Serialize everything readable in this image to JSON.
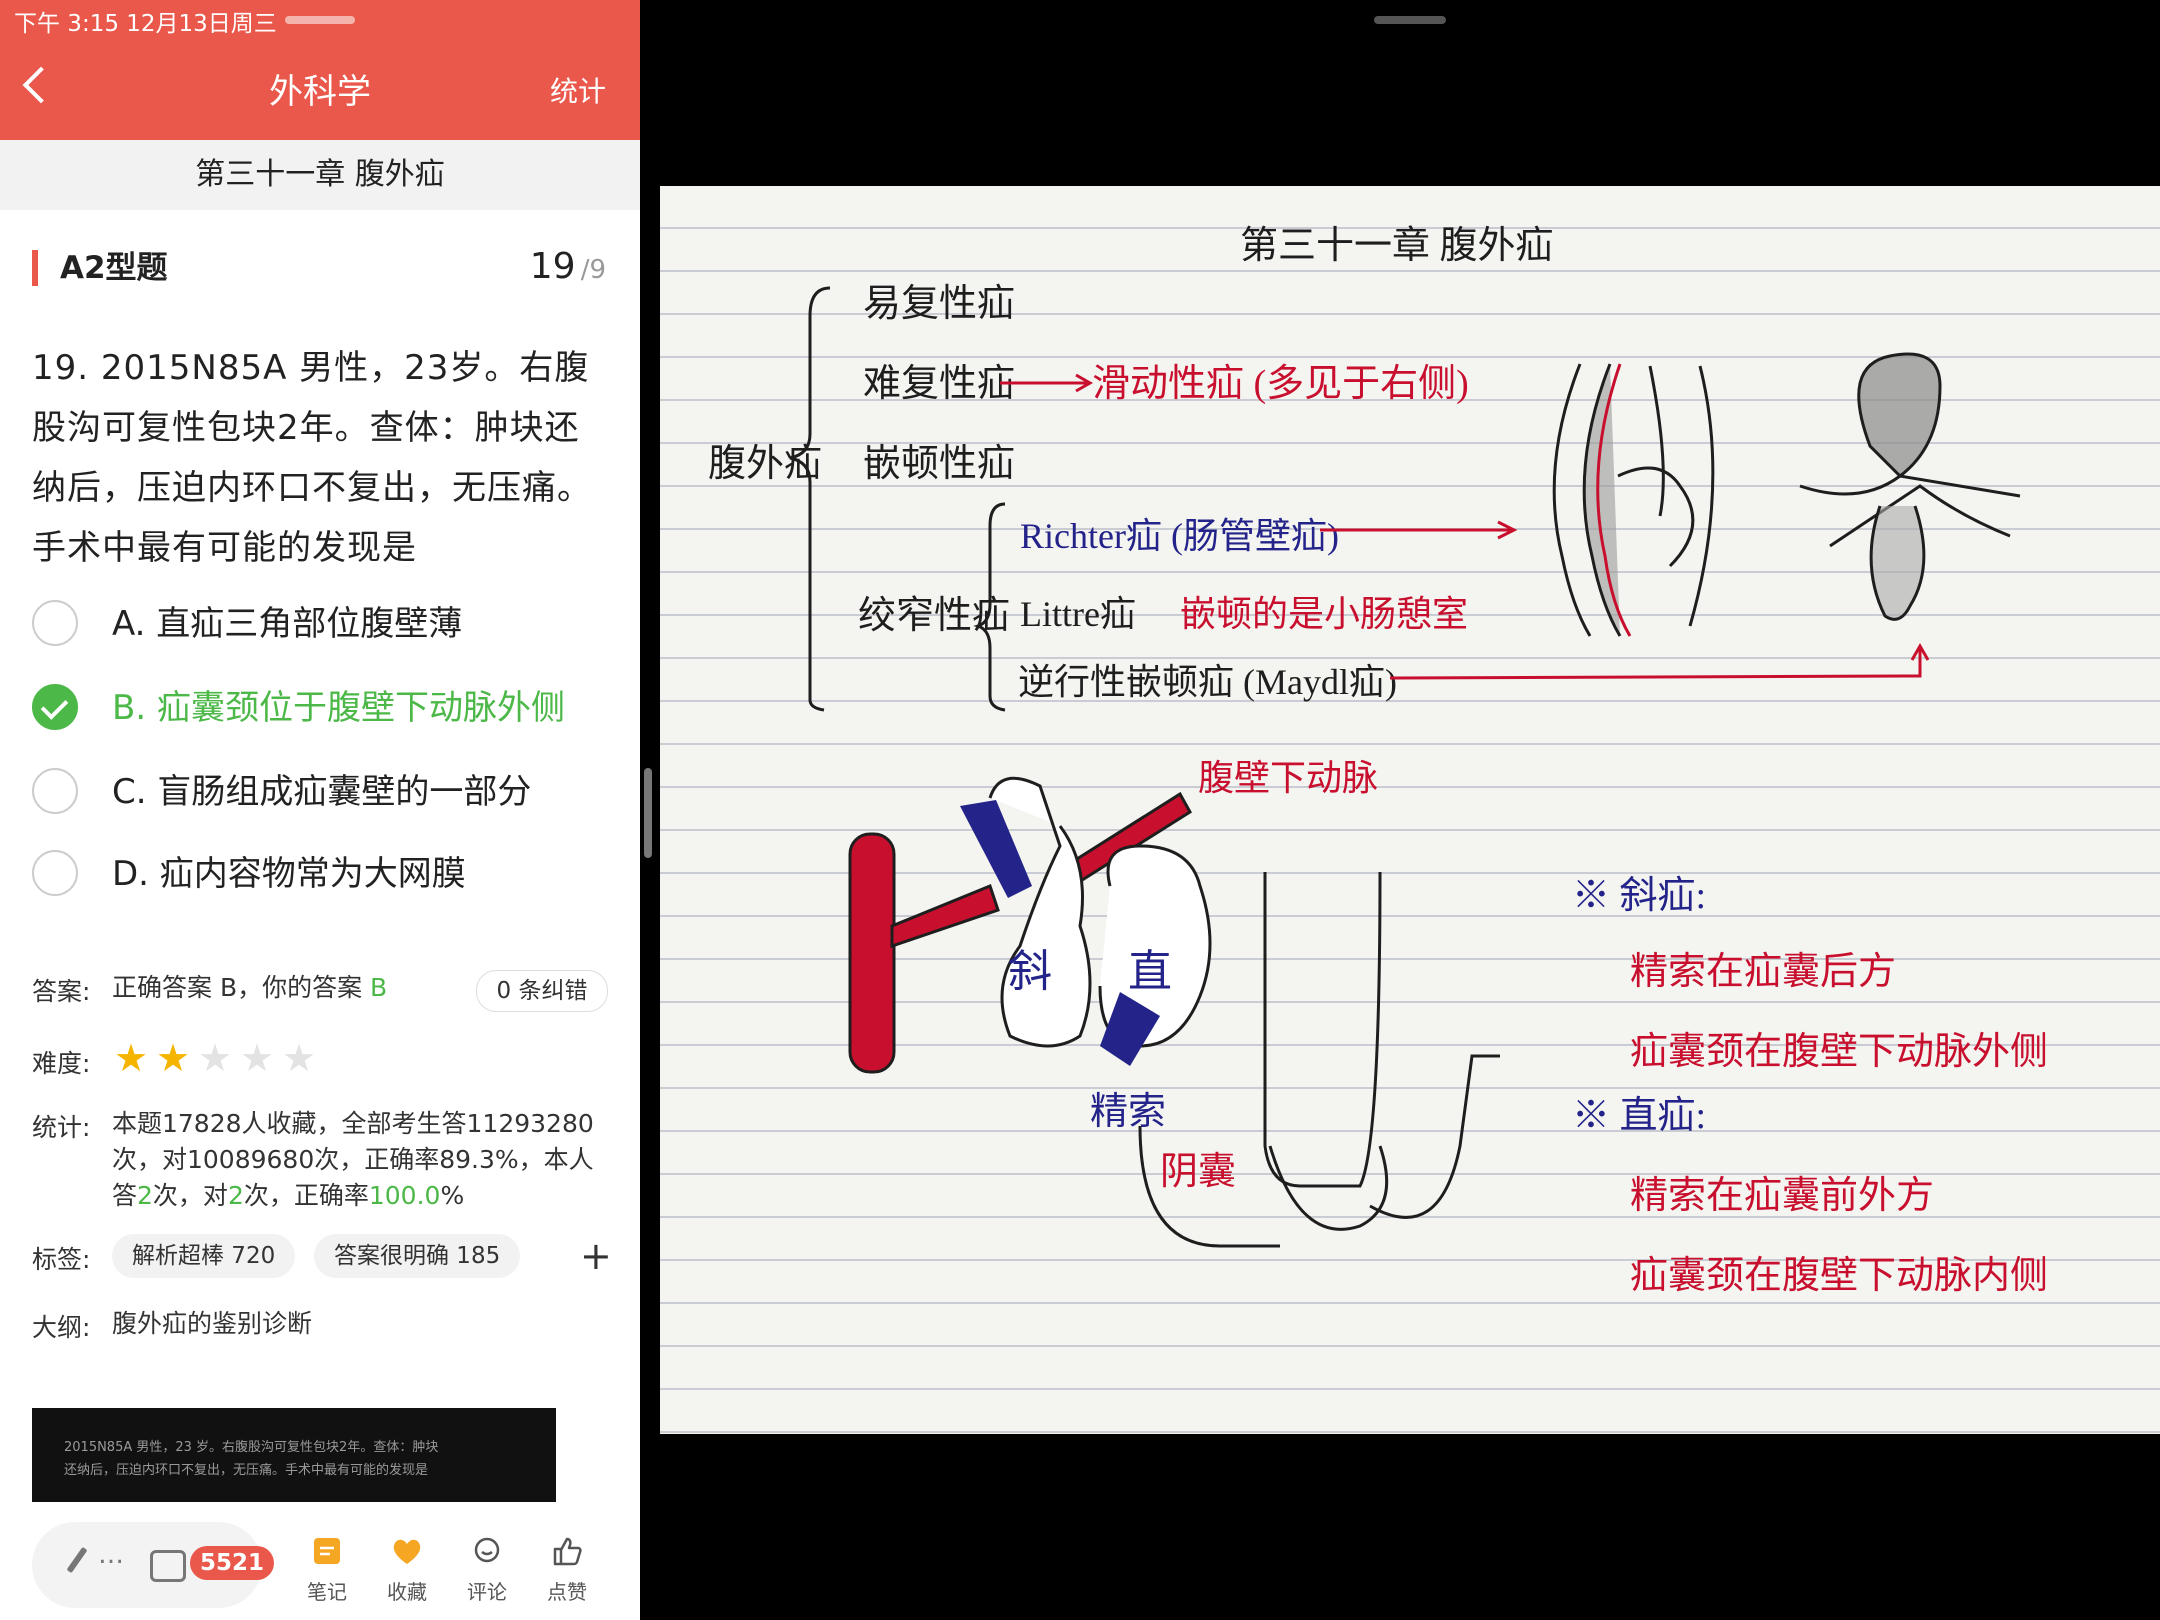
{
  "status_bar": {
    "time": "下午 3:15   12月13日周三"
  },
  "header": {
    "title": "外科学",
    "stat_label": "统计",
    "back_icon": "chevron-left-icon"
  },
  "chapter": "第三十一章 腹外疝",
  "question_type": "A2型题",
  "question_number": {
    "current": "19",
    "total": "/9"
  },
  "question_text": "19. 2015N85A 男性，23岁。右腹股沟可复性包块2年。查体：肿块还纳后，压迫内环口不复出，无压痛。手术中最有可能的发现是",
  "options": [
    {
      "text": "A. 直疝三角部位腹壁薄",
      "selected": false
    },
    {
      "text": "B. 疝囊颈位于腹壁下动脉外侧",
      "selected": true
    },
    {
      "text": "C. 盲肠组成疝囊壁的一部分",
      "selected": false
    },
    {
      "text": "D. 疝内容物常为大网膜",
      "selected": false
    }
  ],
  "answer": {
    "label": "答案:",
    "text": "正确答案 B，你的答案 ",
    "user": "B",
    "corrections": "0 条纠错"
  },
  "difficulty": {
    "label": "难度:",
    "stars_filled": 2,
    "stars_total": 5
  },
  "stats": {
    "label": "统计:",
    "line1": "本题17828人收藏，全部考生答11293280",
    "line2": "次，对10089680次，正确率89.3%，本人",
    "line3_a": "答",
    "line3_b": "2",
    "line3_c": "次，对",
    "line3_d": "2",
    "line3_e": "次，正确率",
    "line3_f": "100.0",
    "line3_g": "%"
  },
  "tags": {
    "label": "标签:",
    "items": [
      {
        "text": "解析超棒 720"
      },
      {
        "text": "答案很明确 185"
      }
    ],
    "add_label": "+"
  },
  "outline": {
    "label": "大纲:",
    "text": "腹外疝的鉴别诊断"
  },
  "thumbnail": {
    "text": "2015N85A 男性，23 岁。右腹股沟可复性包块2年。查体：肿块还纳后，压迫内环口不复出，无压痛。手术中最有可能的发现是"
  },
  "bottom_bar": {
    "pen_dots": "…",
    "comment_count": "5521",
    "items": [
      {
        "label": "笔记",
        "icon": "note-icon",
        "color": "#f5a623"
      },
      {
        "label": "收藏",
        "icon": "heart-icon",
        "color": "#f5a623"
      },
      {
        "label": "评论",
        "icon": "comment-icon",
        "color": "#555555"
      },
      {
        "label": "点赞",
        "icon": "thumbs-up-icon",
        "color": "#555555"
      }
    ]
  },
  "notes": {
    "title": "第三十一章  腹外疝",
    "root": "腹外疝",
    "branches": [
      "易复性疝",
      "难复性疝",
      "嵌顿性疝",
      "绞窄性疝"
    ],
    "sliding": "滑动性疝 (多见于右侧)",
    "strangulated": [
      "Richter疝 (肠管壁疝)",
      "Littre疝",
      "逆行性嵌顿疝 (Maydl疝)"
    ],
    "littre_note": "嵌顿的是小肠憩室",
    "diagram_labels": {
      "artery": "腹壁下动脉",
      "oblique": "斜",
      "direct": "直",
      "cord": "精索",
      "scrotum": "阴囊"
    },
    "oblique_title": "※ 斜疝:",
    "oblique_points": [
      "精索在疝囊后方",
      "疝囊颈在腹壁下动脉外侧"
    ],
    "direct_title": "※ 直疝:",
    "direct_points": [
      "精索在疝囊前外方",
      "疝囊颈在腹壁下动脉内侧"
    ],
    "colors": {
      "ink": "#1e1e1e",
      "red": "#c8102e",
      "blue": "#23238a"
    }
  }
}
